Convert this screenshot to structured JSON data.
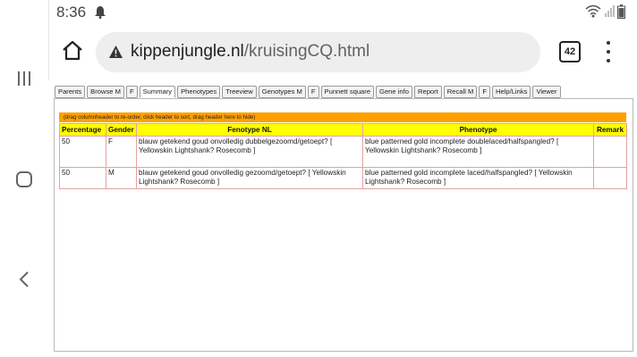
{
  "status": {
    "time": "8:36"
  },
  "browser": {
    "url_domain": "kippenjungle.nl",
    "url_path": "/kruisingCQ.html",
    "tab_count": "42"
  },
  "tabs": [
    {
      "label": "Parents"
    },
    {
      "label": "Browse M"
    },
    {
      "label": "F"
    },
    {
      "label": "Summary"
    },
    {
      "label": "Phenotypes"
    },
    {
      "label": "Treeview"
    },
    {
      "label": "Genotypes M"
    },
    {
      "label": "F"
    },
    {
      "label": "Punnett square"
    },
    {
      "label": "Gene info"
    },
    {
      "label": "Report"
    },
    {
      "label": "Recall M"
    },
    {
      "label": "F"
    },
    {
      "label": "Help/Links"
    },
    {
      "label": "Viewer"
    }
  ],
  "active_tab": "Summary",
  "summary": {
    "hint": "(drag columnheader to re-order, click header to sort, drag header here to hide)",
    "headers": {
      "percentage": "Percentage",
      "gender": "Gender",
      "fenotype_nl": "Fenotype NL",
      "phenotype": "Phenotype",
      "remark": "Remark"
    },
    "rows": [
      {
        "percentage": "50",
        "gender": "F",
        "fenotype_nl": "blauw getekend goud onvolledig dubbelgezoomd/getoept? [ Yellowskin Lightshank? Rosecomb ]",
        "phenotype": "blue patterned gold incomplete doublelaced/halfspangled? [ Yellowskin Lightshank? Rosecomb ]",
        "remark": ""
      },
      {
        "percentage": "50",
        "gender": "M",
        "fenotype_nl": "blauw getekend goud onvolledig gezoomd/getoept? [ Yellowskin Lightshank? Rosecomb ]",
        "phenotype": "blue patterned gold incomplete laced/halfspangled? [ Yellowskin Lightshank? Rosecomb ]",
        "remark": ""
      }
    ]
  },
  "colors": {
    "header_bg": "#ffff00",
    "hint_bar_bg": "#ffa000",
    "cell_border": "#e4a2a2"
  },
  "icons": {
    "status": [
      "notification-bell-icon",
      "wifi-icon",
      "signal-icon",
      "battery-icon"
    ],
    "toolbar": [
      "home-icon",
      "warning-icon",
      "tab-switcher-icon",
      "overflow-menu-icon"
    ],
    "navigation": [
      "recent-apps-icon",
      "home-nav-icon",
      "back-icon"
    ]
  }
}
